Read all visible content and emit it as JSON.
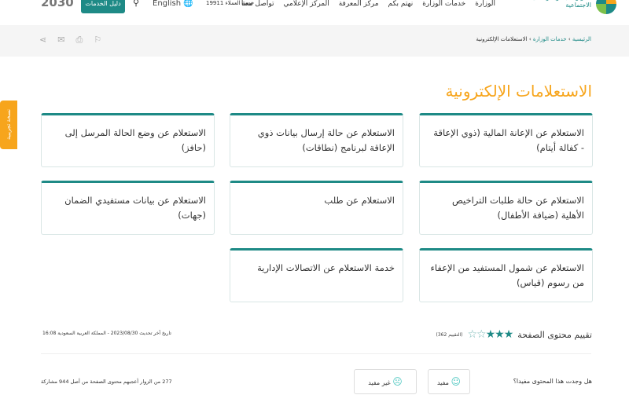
{
  "header": {
    "logo_text": "الموارد البشرية والتنمية الاجتماعية",
    "nav": [
      "الوزارة",
      "خدمات الوزارة",
      "نهتم بكم",
      "مركز المعرفة",
      "المركز الإعلامي",
      "تواصل معنا"
    ],
    "hotline": "خدمة العملاء 19911",
    "language": "English",
    "services_guide": "دليل الخدمات",
    "vision": "2030"
  },
  "breadcrumb": {
    "home": "الرئيسية",
    "section": "خدمات الوزارة",
    "current": "الاستعلامات الإلكترونية"
  },
  "title": "الاستعلامات الإلكترونية",
  "side_tab": "نسخة تجريبية",
  "cards": [
    "الاستعلام عن الإعانة المالية (ذوي الإعاقة - كفالة أيتام)",
    "الاستعلام عن حالة إرسال بيانات ذوي الإعاقة لبرنامج (نطاقات)",
    "الاستعلام عن وضع الحالة المرسل إلى (حافز)",
    "الاستعلام عن حالة طلبات التراخيص الأهلية (ضيافة الأطفال)",
    "الاستعلام عن طلب",
    "الاستعلام عن بيانات مستفيدي الضمان (جهات)",
    "الاستعلام عن شمول المستفيد من الإعفاء من رسوم (قياس)",
    "خدمة الاستعلام عن الاتصالات الإدارية"
  ],
  "rating": {
    "label": "تقييم محتوى الصفحة",
    "stars": 3,
    "max": 5,
    "count": "(التقييم 362)"
  },
  "updated": "تاريخ آخر تحديث 2023/08/30 - المملكة العربية السعودية 16:08",
  "feedback": {
    "question": "هل وجدت هذا المحتوى مفيدا؟",
    "useful": "مفيد",
    "not_useful": "غير مفيد",
    "stats": "277 من الزوار أعجبهم محتوى الصفحة من أصل 944 مشاركة"
  },
  "colors": {
    "accent": "#1e8a86",
    "orange": "#f7a51c"
  }
}
